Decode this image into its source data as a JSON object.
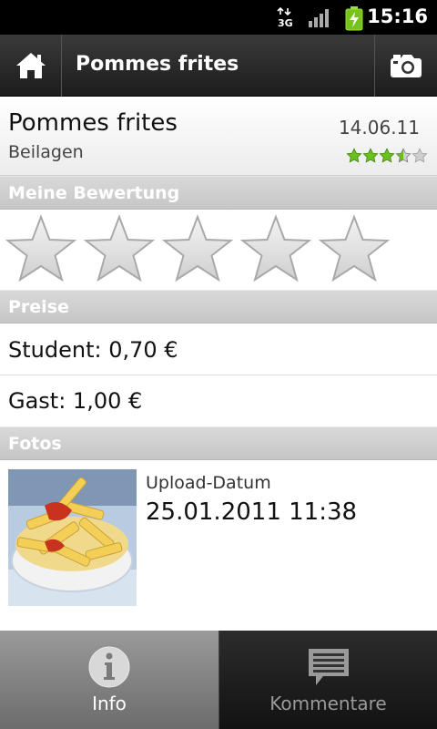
{
  "status_bar": {
    "time": "15:16",
    "network": "3G",
    "icons": [
      "data-3g-icon",
      "signal-icon",
      "battery-charging-icon"
    ]
  },
  "action_bar": {
    "title": "Pommes frites",
    "home_icon": "home-icon",
    "camera_icon": "camera-icon"
  },
  "dish": {
    "name": "Pommes frites",
    "category": "Beilagen",
    "date": "14.06.11",
    "average_rating": 3.5,
    "rating_max": 5
  },
  "my_rating": {
    "header": "Meine Bewertung",
    "value": 0,
    "max": 5
  },
  "prices": {
    "header": "Preise",
    "student": "Student: 0,70 €",
    "guest": "Gast: 1,00 €"
  },
  "photos": {
    "header": "Fotos",
    "upload_label": "Upload-Datum",
    "upload_value": "25.01.2011 11:38"
  },
  "tabs": [
    {
      "label": "Info",
      "icon": "info-icon",
      "active": true
    },
    {
      "label": "Kommentare",
      "icon": "comment-icon",
      "active": false
    }
  ],
  "colors": {
    "rating_green": "#6bbf1e",
    "section_header": "#c9c9c9",
    "action_bar": "#2a2a2a"
  }
}
